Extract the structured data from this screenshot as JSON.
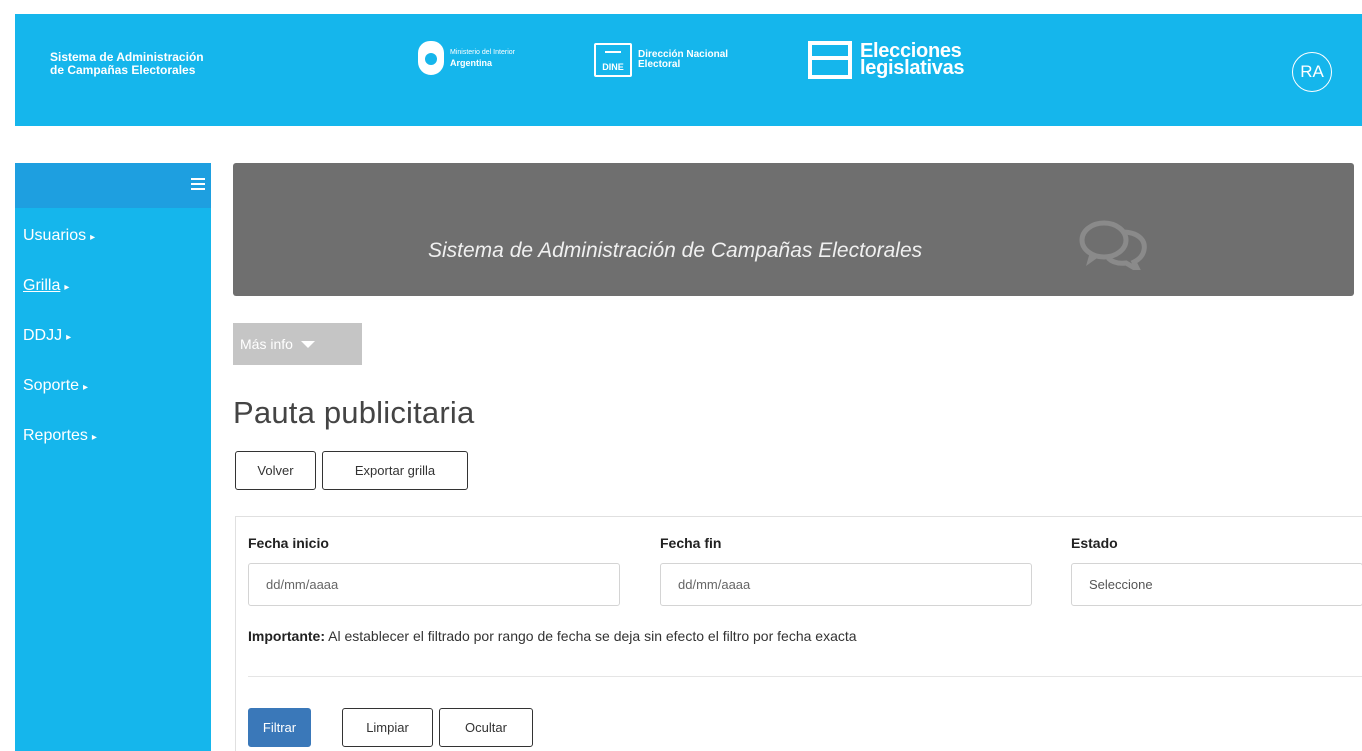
{
  "header": {
    "brand_line1": "Sistema de Administración",
    "brand_line2": "de Campañas Electorales",
    "ministerio_line1": "Ministerio del Interior",
    "ministerio_line2": "Argentina",
    "dine_logo": "DINE",
    "dine_line1": "Dirección Nacional",
    "dine_line2": "Electoral",
    "elecciones_line1": "Elecciones",
    "elecciones_line2": "legislativas",
    "user_initials": "RA",
    "bg_color": "#15b6ec"
  },
  "sidebar": {
    "menu_icon": "hamburger-icon",
    "items": [
      {
        "label": "Usuarios"
      },
      {
        "label": "Grilla"
      },
      {
        "label": "DDJJ"
      },
      {
        "label": "Soporte"
      },
      {
        "label": "Reportes"
      }
    ],
    "caret": "▸"
  },
  "banner": {
    "title": "Sistema de Administración de Campañas Electorales",
    "icon": "chat-bubbles-icon",
    "bg_color": "#6f6f6f"
  },
  "mas_info": {
    "label": "Más info"
  },
  "page": {
    "title": "Pauta publicitaria"
  },
  "actions": {
    "volver": "Volver",
    "exportar": "Exportar grilla"
  },
  "filters": {
    "fecha_inicio": {
      "label": "Fecha inicio",
      "placeholder": "dd/mm/aaaa"
    },
    "fecha_fin": {
      "label": "Fecha fin",
      "placeholder": "dd/mm/aaaa"
    },
    "estado": {
      "label": "Estado",
      "value": "Seleccione"
    },
    "importante_label": "Importante:",
    "importante_text": " Al establecer el filtrado por rango de fecha se deja sin efecto el filtro por fecha exacta",
    "filtrar": "Filtrar",
    "limpiar": "Limpiar",
    "ocultar": "Ocultar",
    "primary_color": "#3a78b9"
  }
}
